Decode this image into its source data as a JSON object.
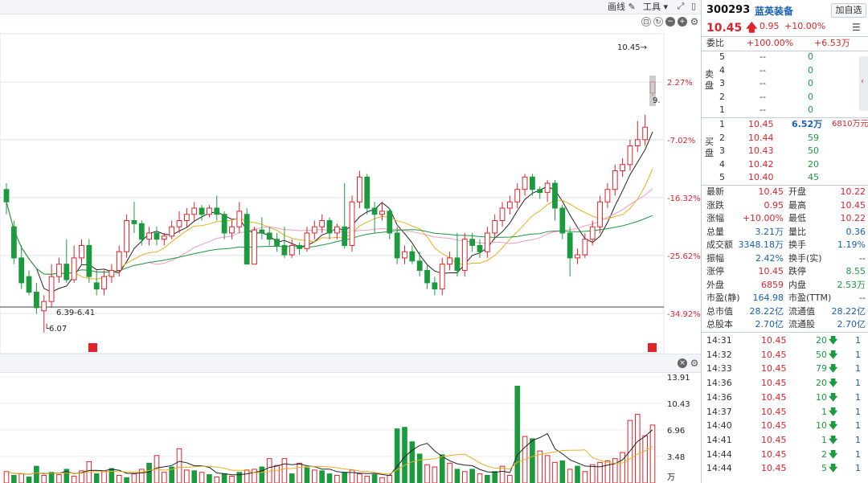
{
  "toolbar": {
    "draw_label": "画线",
    "tools_label": "工具",
    "price_marker": "10.45→",
    "low_marker": "6.07",
    "range_label": "6.39-6.41",
    "truncated_label": "9.",
    "volume_unit": "万"
  },
  "quote": {
    "code": "300293",
    "name": "蓝英装备",
    "add_button": "加自选",
    "last": "10.45",
    "change": "0.95",
    "change_pct": "+10.00%"
  },
  "order_book": {
    "weibi_label": "委比",
    "weibi_pct": "+100.00%",
    "weibi_diff": "+6.53万",
    "sell_label": "卖盘",
    "buy_label": "买盘",
    "sell": [
      {
        "level": "5",
        "price": "--",
        "vol": "0"
      },
      {
        "level": "4",
        "price": "--",
        "vol": "0"
      },
      {
        "level": "3",
        "price": "--",
        "vol": "0"
      },
      {
        "level": "2",
        "price": "--",
        "vol": "0"
      },
      {
        "level": "1",
        "price": "--",
        "vol": "0"
      }
    ],
    "buy": [
      {
        "level": "1",
        "price": "10.45",
        "vol": "6.52万",
        "extra": "6810万元"
      },
      {
        "level": "2",
        "price": "10.44",
        "vol": "59",
        "extra": ""
      },
      {
        "level": "3",
        "price": "10.43",
        "vol": "50",
        "extra": ""
      },
      {
        "level": "4",
        "price": "10.42",
        "vol": "20",
        "extra": ""
      },
      {
        "level": "5",
        "price": "10.40",
        "vol": "45",
        "extra": ""
      }
    ]
  },
  "stats": [
    {
      "l1": "最新",
      "v1": "10.45",
      "c1": "red",
      "l2": "开盘",
      "v2": "10.22",
      "c2": "red"
    },
    {
      "l1": "涨跌",
      "v1": "0.95",
      "c1": "red",
      "l2": "最高",
      "v2": "10.45",
      "c2": "red"
    },
    {
      "l1": "涨幅",
      "v1": "+10.00%",
      "c1": "red",
      "l2": "最低",
      "v2": "10.22",
      "c2": "red"
    },
    {
      "l1": "总量",
      "v1": "3.21万",
      "c1": "blue",
      "l2": "量比",
      "v2": "0.36",
      "c2": "blue"
    },
    {
      "l1": "成交额",
      "v1": "3348.18万",
      "c1": "blue",
      "l2": "换手",
      "v2": "1.19%",
      "c2": "blue"
    },
    {
      "l1": "振幅",
      "v1": "2.42%",
      "c1": "blue",
      "l2": "换手(实)",
      "v2": "--",
      "c2": "dark"
    },
    {
      "l1": "涨停",
      "v1": "10.45",
      "c1": "red",
      "l2": "跌停",
      "v2": "8.55",
      "c2": "green"
    },
    {
      "l1": "外盘",
      "v1": "6859",
      "c1": "red",
      "l2": "内盘",
      "v2": "2.53万",
      "c2": "green"
    },
    {
      "l1": "市盈(静)",
      "v1": "164.98",
      "c1": "blue",
      "l2": "市盈(TTM)",
      "v2": "--",
      "c2": "dark"
    },
    {
      "l1": "总市值",
      "v1": "28.22亿",
      "c1": "blue",
      "l2": "流通值",
      "v2": "28.22亿",
      "c2": "blue"
    },
    {
      "l1": "总股本",
      "v1": "2.70亿",
      "c1": "blue",
      "l2": "流通股",
      "v2": "2.70亿",
      "c2": "blue"
    }
  ],
  "ticks": [
    {
      "time": "14:31",
      "price": "10.45",
      "vol": "20",
      "n": "1"
    },
    {
      "time": "14:32",
      "price": "10.45",
      "vol": "50",
      "n": "1"
    },
    {
      "time": "14:33",
      "price": "10.45",
      "vol": "79",
      "n": "1"
    },
    {
      "time": "14:36",
      "price": "10.45",
      "vol": "20",
      "n": "1"
    },
    {
      "time": "14:36",
      "price": "10.45",
      "vol": "10",
      "n": "1"
    },
    {
      "time": "14:37",
      "price": "10.45",
      "vol": "1",
      "n": "1"
    },
    {
      "time": "14:40",
      "price": "10.45",
      "vol": "10",
      "n": "1"
    },
    {
      "time": "14:41",
      "price": "10.45",
      "vol": "1",
      "n": "1"
    },
    {
      "time": "14:44",
      "price": "10.45",
      "vol": "2",
      "n": "1"
    },
    {
      "time": "14:44",
      "price": "10.45",
      "vol": "5",
      "n": "1"
    }
  ],
  "chart_data": [
    {
      "type": "candlestick",
      "title": "",
      "y_axis_right_labels": [
        "2.27%",
        "-7.02%",
        "-16.32%",
        "-25.62%",
        "-34.92%"
      ],
      "annotations": [
        "10.45→",
        "6.39-6.41",
        "6.07",
        "9."
      ],
      "ylim_pct": [
        -34.92,
        2.27
      ],
      "series_colors": {
        "up": "#e0232b",
        "down": "#1b9a3e",
        "ma5": "#222222",
        "ma10": "#e8b020",
        "ma20": "#f09ac0",
        "ma60": "#1b9a3e"
      },
      "candles": [
        {
          "o": -15.0,
          "c": -17.0,
          "h": -14.0,
          "l": -19.0
        },
        {
          "o": -21.0,
          "c": -26.0,
          "h": -20.0,
          "l": -27.0
        },
        {
          "o": -26.0,
          "c": -30.0,
          "h": -24.0,
          "l": -31.0
        },
        {
          "o": -29.0,
          "c": -31.5,
          "h": -28.0,
          "l": -32.0
        },
        {
          "o": -31.5,
          "c": -34.0,
          "h": -30.0,
          "l": -35.0
        },
        {
          "o": -34.5,
          "c": -33.0,
          "h": -32.0,
          "l": -38.0
        },
        {
          "o": -33.0,
          "c": -29.0,
          "h": -27.0,
          "l": -34.0
        },
        {
          "o": -29.0,
          "c": -27.0,
          "h": -26.0,
          "l": -30.0
        },
        {
          "o": -27.0,
          "c": -29.5,
          "h": -23.0,
          "l": -30.0
        },
        {
          "o": -29.5,
          "c": -26.0,
          "h": -24.0,
          "l": -30.0
        },
        {
          "o": -26.0,
          "c": -24.0,
          "h": -23.0,
          "l": -27.0
        },
        {
          "o": -24.0,
          "c": -29.0,
          "h": -23.0,
          "l": -30.0
        },
        {
          "o": -30.0,
          "c": -31.0,
          "h": -28.0,
          "l": -32.0
        },
        {
          "o": -31.0,
          "c": -29.0,
          "h": -28.0,
          "l": -32.0
        },
        {
          "o": -29.0,
          "c": -28.0,
          "h": -27.0,
          "l": -30.0
        },
        {
          "o": -28.0,
          "c": -25.0,
          "h": -24.0,
          "l": -29.0
        },
        {
          "o": -25.0,
          "c": -20.0,
          "h": -19.0,
          "l": -26.0
        },
        {
          "o": -20.0,
          "c": -20.5,
          "h": -17.0,
          "l": -22.0
        },
        {
          "o": -20.5,
          "c": -23.0,
          "h": -20.0,
          "l": -24.0
        },
        {
          "o": -23.0,
          "c": -22.0,
          "h": -21.0,
          "l": -24.0
        },
        {
          "o": -22.0,
          "c": -23.0,
          "h": -21.0,
          "l": -24.0
        },
        {
          "o": -23.0,
          "c": -22.5,
          "h": -22.0,
          "l": -24.0
        },
        {
          "o": -22.5,
          "c": -21.0,
          "h": -20.0,
          "l": -23.0
        },
        {
          "o": -21.0,
          "c": -20.0,
          "h": -18.5,
          "l": -22.0
        },
        {
          "o": -20.0,
          "c": -19.0,
          "h": -18.0,
          "l": -21.0
        },
        {
          "o": -19.0,
          "c": -18.0,
          "h": -17.0,
          "l": -20.0
        },
        {
          "o": -18.0,
          "c": -19.0,
          "h": -17.5,
          "l": -20.0
        },
        {
          "o": -19.0,
          "c": -18.0,
          "h": -17.5,
          "l": -19.5
        },
        {
          "o": -18.0,
          "c": -19.0,
          "h": -16.0,
          "l": -20.0
        },
        {
          "o": -19.0,
          "c": -22.0,
          "h": -18.5,
          "l": -23.0
        },
        {
          "o": -22.0,
          "c": -21.0,
          "h": -20.0,
          "l": -23.0
        },
        {
          "o": -21.0,
          "c": -18.5,
          "h": -17.0,
          "l": -22.0
        },
        {
          "o": -19.0,
          "c": -27.0,
          "h": -18.0,
          "l": -27.0
        },
        {
          "o": -27.0,
          "c": -21.5,
          "h": -21.0,
          "l": -27.0
        },
        {
          "o": -21.5,
          "c": -22.0,
          "h": -19.5,
          "l": -23.0
        },
        {
          "o": -22.0,
          "c": -23.0,
          "h": -21.0,
          "l": -24.0
        },
        {
          "o": -23.0,
          "c": -24.0,
          "h": -22.0,
          "l": -25.0
        },
        {
          "o": -24.0,
          "c": -25.5,
          "h": -21.0,
          "l": -26.0
        },
        {
          "o": -25.5,
          "c": -24.0,
          "h": -23.0,
          "l": -26.0
        },
        {
          "o": -24.0,
          "c": -24.5,
          "h": -23.5,
          "l": -25.5
        },
        {
          "o": -24.5,
          "c": -22.0,
          "h": -21.0,
          "l": -25.0
        },
        {
          "o": -22.0,
          "c": -21.0,
          "h": -20.0,
          "l": -23.0
        },
        {
          "o": -21.0,
          "c": -20.0,
          "h": -19.0,
          "l": -22.0
        },
        {
          "o": -20.0,
          "c": -22.0,
          "h": -19.5,
          "l": -23.0
        },
        {
          "o": -22.0,
          "c": -21.0,
          "h": -20.5,
          "l": -23.0
        },
        {
          "o": -21.0,
          "c": -24.0,
          "h": -14.0,
          "l": -24.5
        },
        {
          "o": -24.0,
          "c": -17.0,
          "h": -16.0,
          "l": -25.0
        },
        {
          "o": -17.0,
          "c": -13.0,
          "h": -12.0,
          "l": -18.0
        },
        {
          "o": -13.0,
          "c": -18.0,
          "h": -12.5,
          "l": -19.0
        },
        {
          "o": -18.0,
          "c": -19.0,
          "h": -17.0,
          "l": -22.0
        },
        {
          "o": -19.0,
          "c": -18.5,
          "h": -17.0,
          "l": -20.0
        },
        {
          "o": -18.5,
          "c": -22.0,
          "h": -18.0,
          "l": -23.0
        },
        {
          "o": -22.0,
          "c": -26.0,
          "h": -21.0,
          "l": -27.0
        },
        {
          "o": -26.0,
          "c": -25.0,
          "h": -24.0,
          "l": -27.0
        },
        {
          "o": -25.0,
          "c": -26.5,
          "h": -24.0,
          "l": -27.0
        },
        {
          "o": -26.5,
          "c": -28.0,
          "h": -25.0,
          "l": -29.0
        },
        {
          "o": -28.0,
          "c": -30.0,
          "h": -27.0,
          "l": -31.0
        },
        {
          "o": -30.0,
          "c": -31.0,
          "h": -29.0,
          "l": -32.0
        },
        {
          "o": -31.0,
          "c": -27.0,
          "h": -26.0,
          "l": -32.0
        },
        {
          "o": -27.0,
          "c": -26.0,
          "h": -25.0,
          "l": -28.0
        },
        {
          "o": -26.0,
          "c": -28.0,
          "h": -22.0,
          "l": -29.0
        },
        {
          "o": -28.0,
          "c": -23.0,
          "h": -22.0,
          "l": -29.0
        },
        {
          "o": -23.0,
          "c": -24.0,
          "h": -22.0,
          "l": -25.0
        },
        {
          "o": -24.0,
          "c": -25.0,
          "h": -23.0,
          "l": -26.0
        },
        {
          "o": -25.0,
          "c": -22.0,
          "h": -21.0,
          "l": -26.0
        },
        {
          "o": -22.0,
          "c": -20.0,
          "h": -19.0,
          "l": -23.0
        },
        {
          "o": -20.0,
          "c": -18.0,
          "h": -17.0,
          "l": -21.0
        },
        {
          "o": -18.0,
          "c": -17.0,
          "h": -16.0,
          "l": -19.0
        },
        {
          "o": -17.0,
          "c": -15.0,
          "h": -14.0,
          "l": -18.0
        },
        {
          "o": -15.0,
          "c": -13.0,
          "h": -12.5,
          "l": -16.0
        },
        {
          "o": -13.0,
          "c": -15.0,
          "h": -12.5,
          "l": -16.0
        },
        {
          "o": -15.0,
          "c": -15.5,
          "h": -14.5,
          "l": -16.5
        },
        {
          "o": -15.5,
          "c": -14.0,
          "h": -13.5,
          "l": -17.0
        },
        {
          "o": -14.0,
          "c": -18.0,
          "h": -13.5,
          "l": -20.0
        },
        {
          "o": -18.0,
          "c": -22.0,
          "h": -17.5,
          "l": -23.0
        },
        {
          "o": -22.0,
          "c": -26.0,
          "h": -21.0,
          "l": -29.0
        },
        {
          "o": -26.0,
          "c": -25.5,
          "h": -24.5,
          "l": -27.0
        },
        {
          "o": -25.5,
          "c": -23.0,
          "h": -22.0,
          "l": -26.0
        },
        {
          "o": -23.0,
          "c": -21.0,
          "h": -20.0,
          "l": -24.0
        },
        {
          "o": -21.0,
          "c": -17.0,
          "h": -16.0,
          "l": -22.0
        },
        {
          "o": -17.0,
          "c": -15.0,
          "h": -14.0,
          "l": -18.0
        },
        {
          "o": -15.0,
          "c": -12.0,
          "h": -11.0,
          "l": -16.0
        },
        {
          "o": -12.0,
          "c": -11.0,
          "h": -10.0,
          "l": -13.0
        },
        {
          "o": -11.0,
          "c": -8.0,
          "h": -7.0,
          "l": -12.0
        },
        {
          "o": -8.0,
          "c": -7.0,
          "h": -4.0,
          "l": -9.0
        },
        {
          "o": -7.0,
          "c": -5.0,
          "h": -3.0,
          "l": -8.0
        },
        {
          "o": 0.5,
          "c": 2.27,
          "h": 2.27,
          "l": 0.0
        }
      ]
    },
    {
      "type": "bar",
      "title": "",
      "y_axis_right_labels": [
        "13.91",
        "10.43",
        "6.96",
        "3.48"
      ],
      "unit": "万",
      "ylim": [
        0,
        13.91
      ],
      "values": [
        1.5,
        1.0,
        1.2,
        0.8,
        2.2,
        1.0,
        1.4,
        1.1,
        1.8,
        0.9,
        1.6,
        2.8,
        1.2,
        1.5,
        1.9,
        1.0,
        0.7,
        1.2,
        1.8,
        2.6,
        3.6,
        1.4,
        2.1,
        4.5,
        1.7,
        1.6,
        1.4,
        1.1,
        0.8,
        1.2,
        0.9,
        1.4,
        1.7,
        1.8,
        2.1,
        3.2,
        2.3,
        3.2,
        1.2,
        2.6,
        2.0,
        1.7,
        1.6,
        1.2,
        1.0,
        1.4,
        1.7,
        1.2,
        0.9,
        1.1,
        0.7,
        1.0,
        7.1,
        7.3,
        5.4,
        3.8,
        2.4,
        2.1,
        3.7,
        2.6,
        1.8,
        1.5,
        1.8,
        1.2,
        1.0,
        1.5,
        2.2,
        1.0,
        12.7,
        6.1,
        5.8,
        4.2,
        3.6,
        2.7,
        2.9,
        1.8,
        2.2,
        1.5,
        2.4,
        2.7,
        2.9,
        3.2,
        4.0,
        8.2,
        9.0,
        6.2,
        7.6
      ],
      "up": [
        true,
        false,
        true,
        false,
        false,
        true,
        false,
        true,
        false,
        true,
        true,
        true,
        false,
        true,
        false,
        true,
        false,
        true,
        true,
        false,
        true,
        true,
        false,
        true,
        true,
        false,
        true,
        false,
        true,
        false,
        true,
        false,
        true,
        true,
        false,
        true,
        true,
        true,
        false,
        true,
        false,
        true,
        false,
        false,
        true,
        false,
        true,
        true,
        true,
        false,
        true,
        true,
        false,
        false,
        false,
        false,
        true,
        true,
        false,
        true,
        false,
        true,
        false,
        true,
        false,
        false,
        true,
        true,
        false,
        true,
        false,
        true,
        true,
        true,
        false,
        true,
        false,
        true,
        true,
        true,
        true,
        true,
        true,
        true,
        true,
        true,
        true
      ]
    }
  ]
}
